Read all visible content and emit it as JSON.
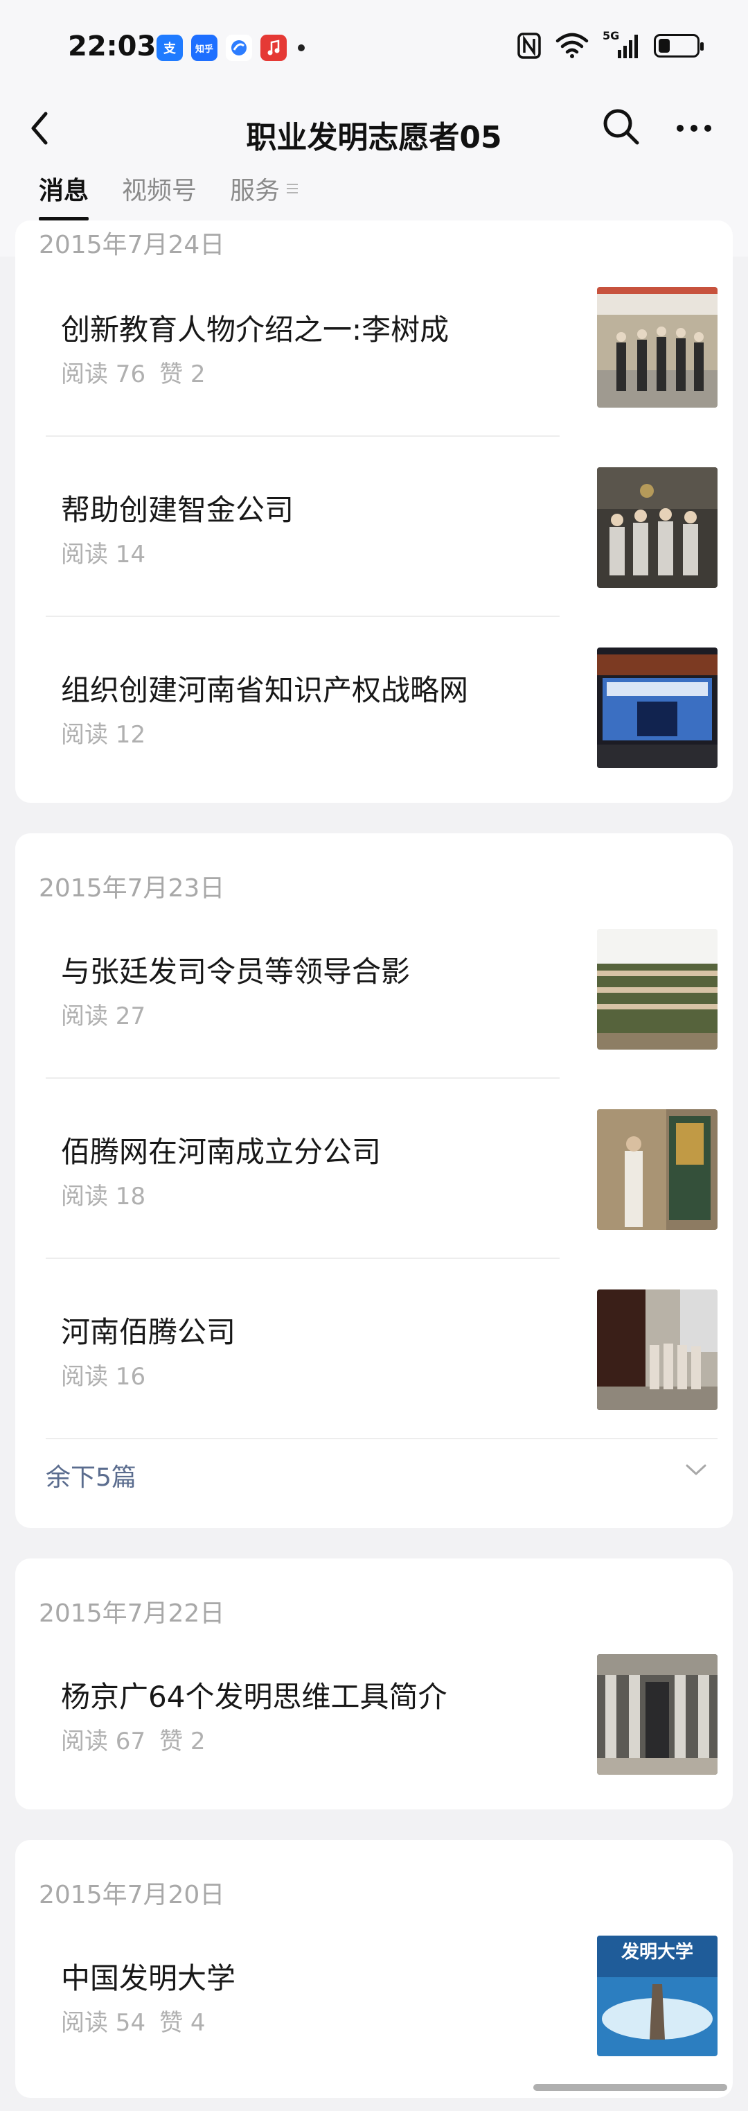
{
  "status_bar": {
    "time": "22:03",
    "apps": [
      "alipay-icon",
      "zhihu-icon",
      "cloud-icon",
      "music-icon"
    ],
    "zhihu_label": "知乎",
    "alipay_label": "支",
    "network_label": "5G",
    "battery_level": 0.3
  },
  "header": {
    "title": "职业发明志愿者05",
    "tabs": [
      {
        "label": "消息",
        "active": true
      },
      {
        "label": "视频号",
        "active": false
      },
      {
        "label": "服务",
        "active": false
      }
    ]
  },
  "groups": [
    {
      "date": "2015年7月24日",
      "articles": [
        {
          "title": "创新教育人物介绍之一:李树成",
          "reads": "阅读 76",
          "likes": "赞 2"
        },
        {
          "title": "帮助创建智金公司",
          "reads": "阅读 14",
          "likes": ""
        },
        {
          "title": "组织创建河南省知识产权战略网",
          "reads": "阅读 12",
          "likes": ""
        }
      ]
    },
    {
      "date": "2015年7月23日",
      "articles": [
        {
          "title": "与张廷发司令员等领导合影",
          "reads": "阅读 27",
          "likes": ""
        },
        {
          "title": "佰腾网在河南成立分公司",
          "reads": "阅读 18",
          "likes": ""
        },
        {
          "title": "河南佰腾公司",
          "reads": "阅读 16",
          "likes": ""
        }
      ],
      "more_label": "余下5篇"
    },
    {
      "date": "2015年7月22日",
      "articles": [
        {
          "title": "杨京广64个发明思维工具简介",
          "reads": "阅读 67",
          "likes": "赞 2"
        }
      ]
    },
    {
      "date": "2015年7月20日",
      "articles": [
        {
          "title": "中国发明大学",
          "reads": "阅读 54",
          "likes": "赞 4",
          "thumb_text": "发明大学"
        }
      ]
    }
  ],
  "colors": {
    "page_bg": "#f2f2f4",
    "card_bg": "#ffffff",
    "meta": "#b0b0b0",
    "link": "#5a6c8e"
  }
}
